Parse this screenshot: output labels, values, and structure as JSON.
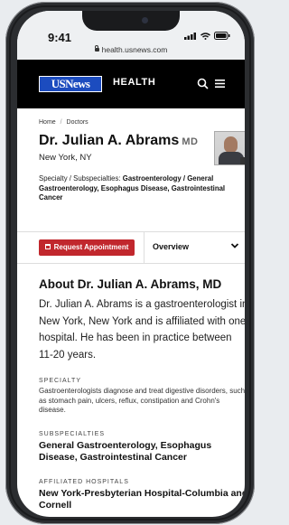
{
  "status": {
    "time": "9:41"
  },
  "browser": {
    "url": "health.usnews.com"
  },
  "header": {
    "logo_text": "USNews",
    "section": "HEALTH"
  },
  "breadcrumb": {
    "home": "Home",
    "separator": "/",
    "current": "Doctors"
  },
  "doctor": {
    "name": "Dr. Julian A. Abrams",
    "credential": "MD",
    "location": "New York, NY",
    "specialty_label": "Specialty / Subspecialties:",
    "specialty_value": "Gastroenterology / General Gastroenterology, Esophagus Disease, Gastrointestinal Cancer"
  },
  "actions": {
    "request_label": "Request Appointment",
    "overview_label": "Overview"
  },
  "about": {
    "title": "About Dr. Julian A. Abrams, MD",
    "text": "Dr. Julian A. Abrams is a gastroenterologist in New York, New York and is affiliated with one hospital. He has been in practice between 11-20 years."
  },
  "specialty": {
    "label": "SPECIALTY",
    "description": "Gastroenterologists diagnose and treat digestive disorders, such as stomach pain, ulcers, reflux, constipation and Crohn's disease."
  },
  "subspecialties": {
    "label": "SUBSPECIALTIES",
    "value": "General Gastroenterology, Esophagus Disease, Gastrointestinal Cancer"
  },
  "hospitals": {
    "label": "AFFILIATED HOSPITALS",
    "value": "New York-Presbyterian Hospital-Columbia and Cornell"
  },
  "colors": {
    "accent": "#c1272d",
    "logo_blue": "#1c4cbf",
    "nav_bg": "#000000"
  },
  "icons": [
    "search-icon",
    "menu-icon",
    "calendar-icon",
    "chevron-down-icon",
    "lock-icon",
    "signal-icon",
    "wifi-icon",
    "battery-icon"
  ]
}
